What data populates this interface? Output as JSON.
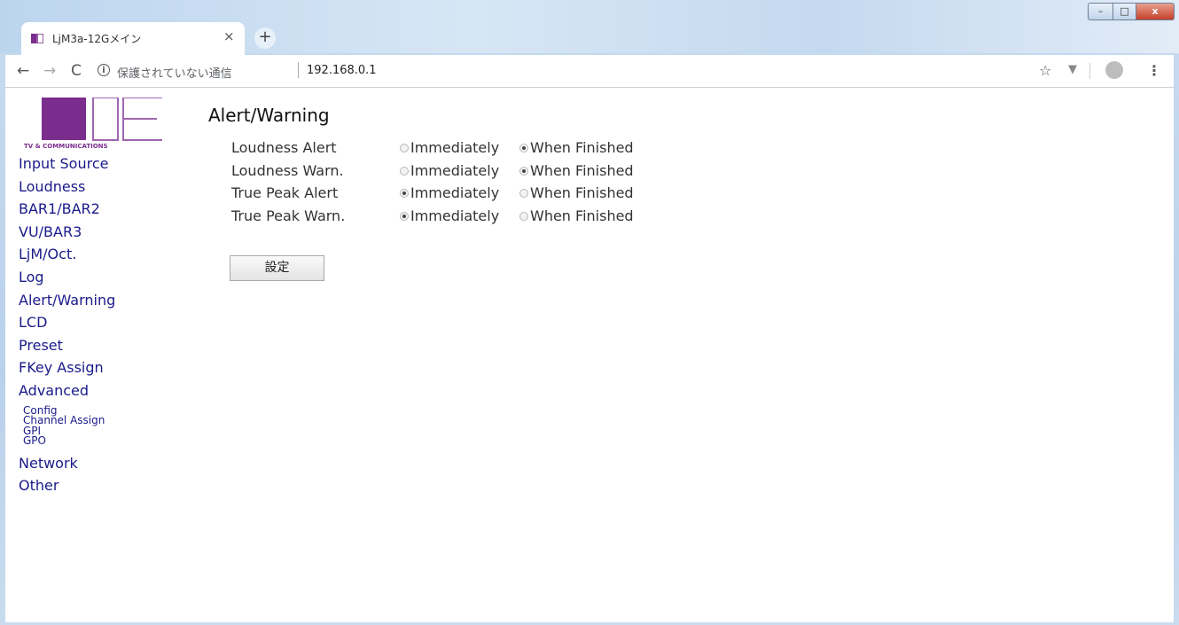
{
  "browser": {
    "tab_title": "LjM3a-12Gメイン",
    "tab_close": "×",
    "new_tab": "+",
    "security_text": "保護されていない通信",
    "url": "192.168.0.1",
    "window_controls": {
      "minimize": "–",
      "maximize": "□",
      "close": "x"
    },
    "icons": [
      "back-arrow-icon",
      "forward-arrow-icon",
      "reload-icon",
      "info-icon",
      "star-icon",
      "extension-icon",
      "profile-icon",
      "menu-icon"
    ]
  },
  "sidebar": {
    "logo_text": "TV & COMMUNICATIONS",
    "items": [
      {
        "label": "Input Source"
      },
      {
        "label": "Loudness"
      },
      {
        "label": "BAR1/BAR2"
      },
      {
        "label": "VU/BAR3"
      },
      {
        "label": "LjM/Oct."
      },
      {
        "label": "Log"
      },
      {
        "label": "Alert/Warning"
      },
      {
        "label": "LCD"
      },
      {
        "label": "Preset"
      },
      {
        "label": "FKey Assign"
      },
      {
        "label": "Advanced"
      }
    ],
    "advanced_subitems": [
      {
        "label": "Config"
      },
      {
        "label": "Channel Assign"
      },
      {
        "label": "GPI"
      },
      {
        "label": "GPO"
      }
    ],
    "bottom_items": [
      {
        "label": "Network"
      },
      {
        "label": "Other"
      }
    ]
  },
  "main": {
    "title": "Alert/Warning",
    "option_labels": {
      "immediately": "Immediately",
      "when_finished": "When Finished"
    },
    "rows": [
      {
        "label": "Loudness Alert",
        "selected": "When Finished"
      },
      {
        "label": "Loudness Warn.",
        "selected": "When Finished"
      },
      {
        "label": "True Peak Alert",
        "selected": "Immediately"
      },
      {
        "label": "True Peak Warn.",
        "selected": "Immediately"
      }
    ],
    "submit_label": "設定"
  },
  "colors": {
    "nav_link": "#1a1a8a",
    "logo_purple": "#7b2d8e"
  }
}
